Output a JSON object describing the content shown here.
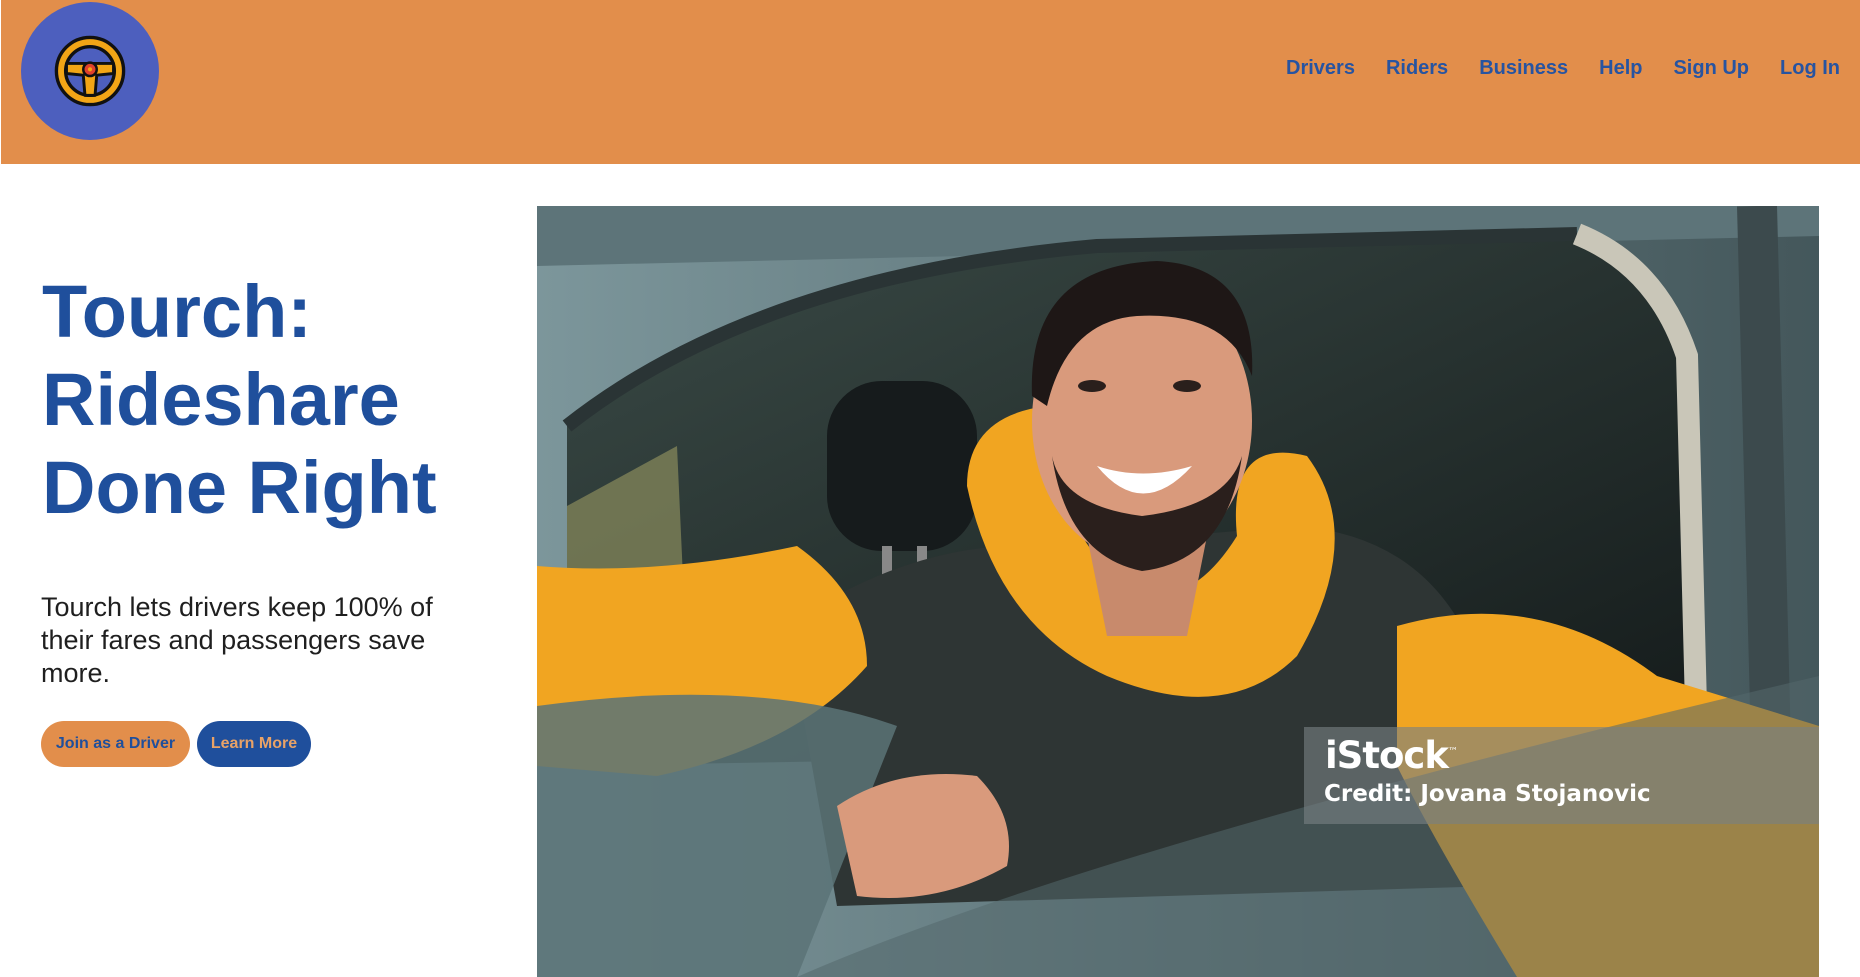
{
  "header": {
    "logo_icon": "steering-wheel-icon",
    "background_color": "#e28e4b",
    "logo_circle_color": "#4d5fbe",
    "nav": [
      {
        "label": "Drivers"
      },
      {
        "label": "Riders"
      },
      {
        "label": "Business"
      },
      {
        "label": "Help"
      },
      {
        "label": "Sign Up"
      },
      {
        "label": "Log In"
      }
    ]
  },
  "hero": {
    "title_lines": [
      "Tourch:",
      "Rideshare",
      "Done Right"
    ],
    "subtitle": "Tourch lets drivers keep 100% of their fares and passengers save more.",
    "buttons": {
      "join_label": "Join as a Driver",
      "learn_label": "Learn More"
    },
    "title_color": "#1f4f9c"
  },
  "photo": {
    "watermark_brand": "iStock",
    "watermark_trademark": "™",
    "credit": "Credit: Jovana Stojanovic"
  }
}
